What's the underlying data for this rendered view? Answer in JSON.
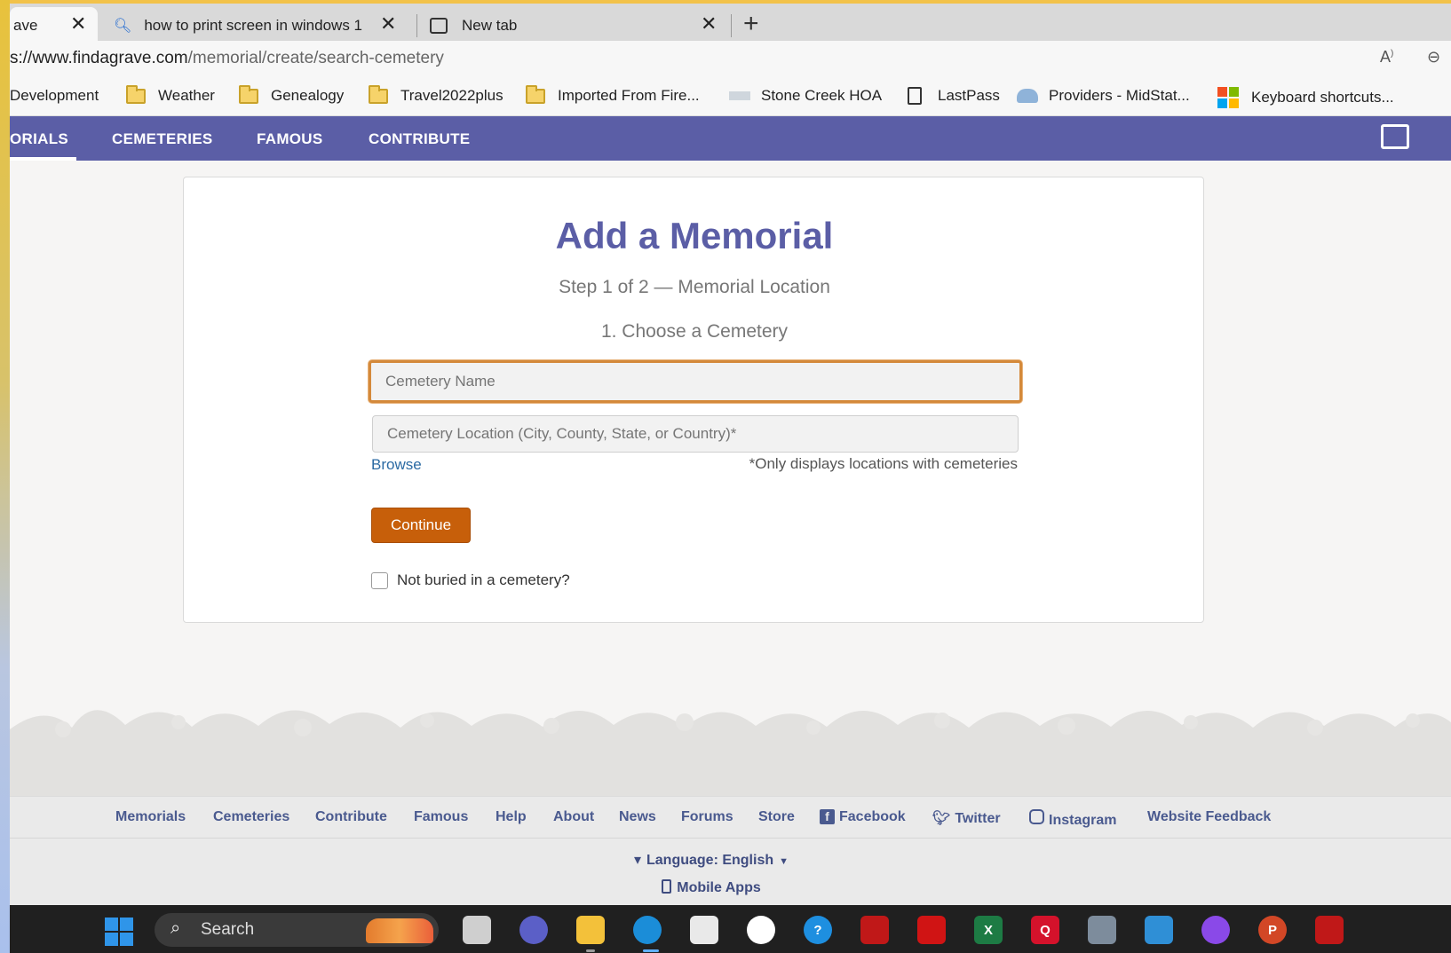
{
  "browser": {
    "tabs": [
      {
        "title": "ave",
        "active": true
      },
      {
        "title": "how to print screen in windows 1",
        "active": false
      },
      {
        "title": "New tab",
        "active": false
      }
    ],
    "url_domain": "s://www.findagrave.com",
    "url_path": "/memorial/create/search-cemetery",
    "bookmarks": [
      "Development",
      "Weather",
      "Genealogy",
      "Travel2022plus",
      "Imported From Fire...",
      "Stone Creek HOA",
      "LastPass",
      "Providers - MidStat...",
      "Keyboard shortcuts..."
    ]
  },
  "site_nav": {
    "items": [
      "ORIALS",
      "CEMETERIES",
      "FAMOUS",
      "CONTRIBUTE"
    ]
  },
  "form": {
    "title": "Add a Memorial",
    "step": "Step 1 of 2 — Memorial Location",
    "subheading": "1. Choose a Cemetery",
    "cemetery_name_placeholder": "Cemetery Name",
    "cemetery_location_placeholder": "Cemetery Location (City, County, State, or Country)*",
    "browse_label": "Browse",
    "location_note": "*Only displays locations with cemeteries",
    "continue_label": "Continue",
    "not_buried_label": "Not buried in a cemetery?",
    "not_buried_checked": false
  },
  "footer": {
    "links": [
      "Memorials",
      "Cemeteries",
      "Contribute",
      "Famous",
      "Help",
      "About",
      "News",
      "Forums",
      "Store"
    ],
    "social": [
      "Facebook",
      "Twitter",
      "Instagram"
    ],
    "feedback": "Website Feedback",
    "language": "Language: English",
    "mobile_apps": "Mobile Apps"
  },
  "taskbar": {
    "search_label": "Search"
  },
  "colors": {
    "brand_purple": "#5b5ea6",
    "continue_orange": "#c75f0a",
    "focus_ring": "#d4893a",
    "footer_link": "#4a5a8f"
  }
}
